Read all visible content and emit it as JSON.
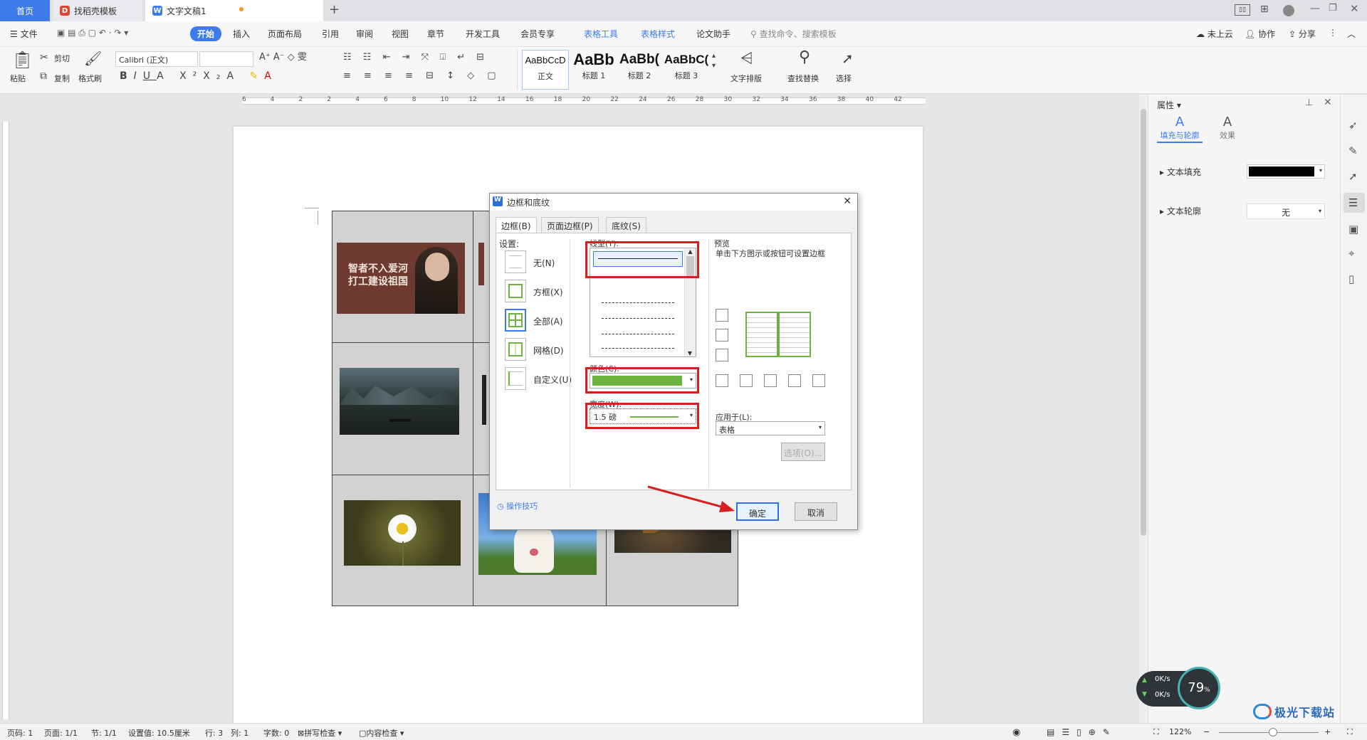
{
  "tabs": {
    "home": "首页",
    "template": "找稻壳模板",
    "document": "文字文稿1",
    "add": "+"
  },
  "menubar": {
    "file": "文件",
    "items": [
      "开始",
      "插入",
      "页面布局",
      "引用",
      "审阅",
      "视图",
      "章节",
      "开发工具",
      "会员专享"
    ],
    "context_items": [
      "表格工具",
      "表格样式"
    ],
    "paper": "论文助手",
    "search_placeholder": "查找命令、搜索模板",
    "cloud": "未上云",
    "collab": "协作",
    "share": "分享"
  },
  "ribbon": {
    "paste": "粘贴",
    "cut": "剪切",
    "copy": "复制",
    "format_painter": "格式刷",
    "font_name": "Calibri (正文)",
    "font_size": "",
    "styles": [
      {
        "sample": "AaBbCcD",
        "label": "正文"
      },
      {
        "sample": "AaBb",
        "label": "标题 1"
      },
      {
        "sample": "AaBb(",
        "label": "标题 2"
      },
      {
        "sample": "AaBbC(",
        "label": "标题 3"
      }
    ],
    "text_layout": "文字排版",
    "find_replace": "查找替换",
    "select": "选择"
  },
  "ruler": {
    "ticks": [
      "6",
      "4",
      "2",
      "2",
      "4",
      "6",
      "8",
      "10",
      "12",
      "14",
      "16",
      "18",
      "20",
      "22",
      "24",
      "26",
      "28",
      "30",
      "32",
      "34",
      "36",
      "38",
      "40",
      "42"
    ]
  },
  "document": {
    "image1_caption_line1": "智者不入爱河",
    "image1_caption_line2": "打工建设祖国"
  },
  "dialog": {
    "title": "边框和底纹",
    "tabs": [
      "边框(B)",
      "页面边框(P)",
      "底纹(S)"
    ],
    "settings_label": "设置:",
    "settings": [
      "无(N)",
      "方框(X)",
      "全部(A)",
      "网格(D)",
      "自定义(U)"
    ],
    "line_style_label": "线型(Y):",
    "color_label": "颜色(C):",
    "color_value": "#6db33f",
    "width_label": "宽度(W):",
    "width_value": "1.5  磅",
    "preview_label": "预览",
    "preview_hint": "单击下方图示或按钮可设置边框",
    "apply_label": "应用于(L):",
    "apply_value": "表格",
    "options_button": "选项(O)...",
    "tips": "操作技巧",
    "ok": "确定",
    "cancel": "取消"
  },
  "right_panel": {
    "title": "属性",
    "tab_fill": "填充与轮廓",
    "tab_effect": "效果",
    "text_fill": "文本填充",
    "text_fill_color": "#000000",
    "text_outline": "文本轮廓",
    "text_outline_value": "无"
  },
  "status": {
    "page_num": "页码: 1",
    "pages": "页面: 1/1",
    "section": "节: 1/1",
    "setting": "设置值: 10.5厘米",
    "row": "行: 3",
    "col": "列: 1",
    "words": "字数: 0",
    "spell": "拼写检查",
    "content_check": "内容检查",
    "zoom": "122%"
  },
  "net": {
    "up": "0K/s",
    "down": "0K/s",
    "percent": "79",
    "unit": "%"
  },
  "watermark": "极光下载站"
}
